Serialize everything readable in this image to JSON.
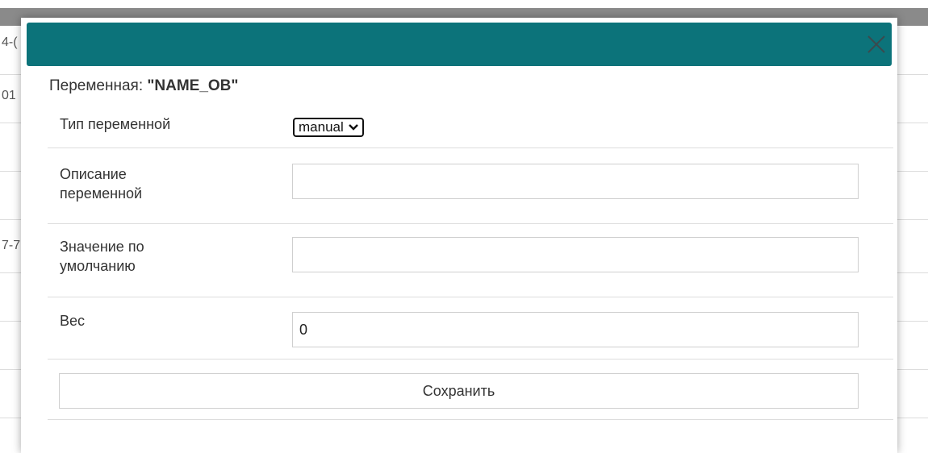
{
  "background": {
    "cells": [
      "4-(",
      "01",
      "",
      "7-7"
    ]
  },
  "modal": {
    "header_color": "#0c737a",
    "close_icon": "close-icon",
    "variable_label": "Переменная: ",
    "variable_name": "\"NAME_OB\"",
    "fields": {
      "type_label": "Тип переменной",
      "type_value": "manual",
      "description_label_line1": "Описание",
      "description_label_line2": "переменной",
      "description_value": "",
      "default_label_line1": "Значение по",
      "default_label_line2": "умолчанию",
      "default_value": "",
      "weight_label": "Вес",
      "weight_value": "0"
    },
    "save_label": "Сохранить"
  }
}
